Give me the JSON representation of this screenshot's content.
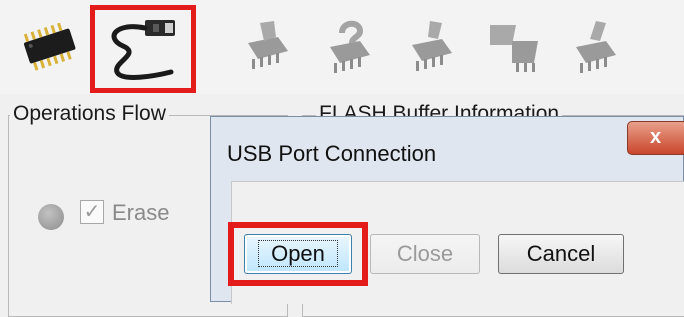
{
  "toolbar": {
    "items": [
      {
        "name": "chip-icon",
        "state": "enabled"
      },
      {
        "name": "usb-cable-icon",
        "state": "highlighted"
      },
      {
        "name": "chip-write-icon",
        "state": "disabled"
      },
      {
        "name": "chip-question-icon",
        "state": "disabled"
      },
      {
        "name": "chip-read-icon",
        "state": "disabled"
      },
      {
        "name": "chip-transfer-icon",
        "state": "disabled"
      },
      {
        "name": "chip-erase-icon",
        "state": "disabled"
      }
    ],
    "highlight_color": "#e41b1b"
  },
  "operations_flow": {
    "title": "Operations Flow",
    "erase_label": "Erase",
    "erase_checked": true
  },
  "flash_buffer": {
    "title": "FLASH Buffer Information"
  },
  "dialog": {
    "title": "USB Port Connection",
    "close_glyph": "x",
    "buttons": {
      "open": "Open",
      "close": "Close",
      "cancel": "Cancel"
    }
  }
}
